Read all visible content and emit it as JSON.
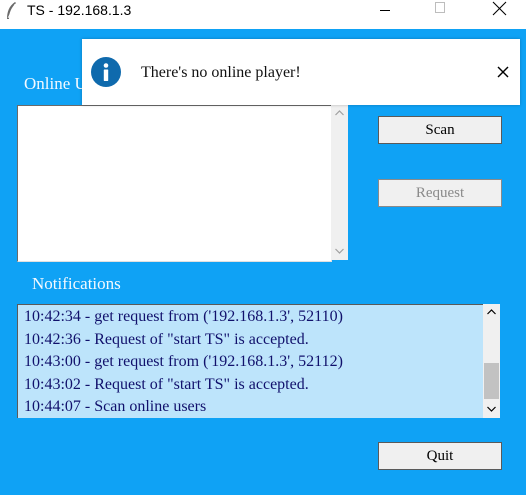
{
  "window": {
    "title": "TS - 192.168.1.3"
  },
  "labels": {
    "online_users": "Online U",
    "notifications": "Notifications"
  },
  "buttons": {
    "scan": "Scan",
    "request": "Request",
    "quit": "Quit"
  },
  "notifications": [
    "10:42:34 - get request from ('192.168.1.3', 52110)",
    "10:42:36 - Request of \"start TS\" is accepted.",
    "10:43:00 - get request from ('192.168.1.3', 52112)",
    "10:43:02 - Request of \"start TS\" is accepted.",
    "10:44:07 - Scan online users"
  ],
  "popup": {
    "message": "There's no online player!",
    "icon": "info-icon"
  },
  "colors": {
    "background": "#0fa2f5",
    "notification_bg": "#bde4fb",
    "info_icon": "#0f6aad"
  }
}
